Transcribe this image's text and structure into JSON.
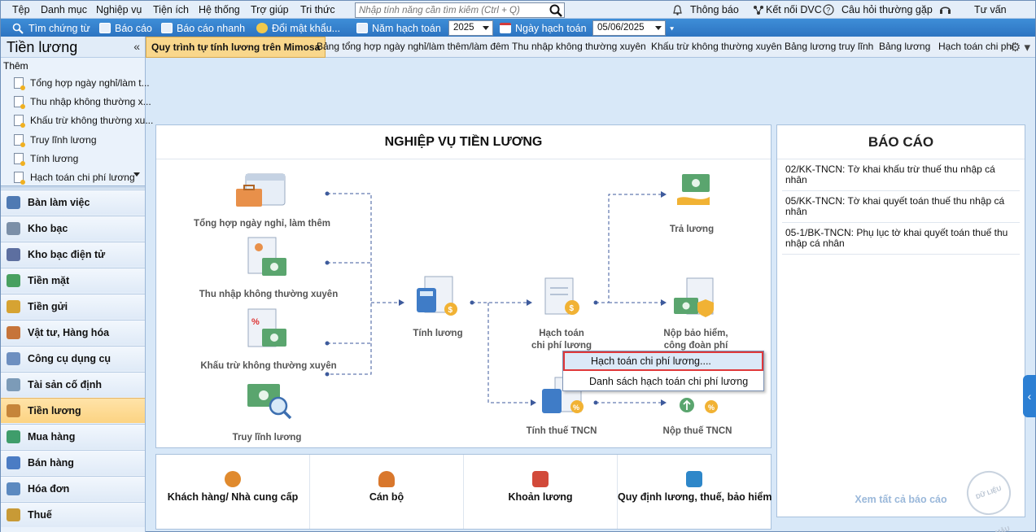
{
  "menubar": {
    "items": [
      "Tệp",
      "Danh mục",
      "Nghiệp vụ",
      "Tiện ích",
      "Hệ thống",
      "Trợ giúp",
      "Tri thức"
    ],
    "search_placeholder": "Nhập tính năng cần tìm kiếm (Ctrl + Q)",
    "notify": "Thông báo",
    "connect": "Kết nối DVC",
    "faq": "Câu hỏi thường gặp",
    "advice": "Tư vấn"
  },
  "toolbar": {
    "find_voucher": "Tìm chứng từ",
    "report": "Báo cáo",
    "quick_report": "Báo cáo nhanh",
    "change_password": "Đổi mật khẩu...",
    "fiscal_year_label": "Năm hạch toán",
    "fiscal_year_value": "2025",
    "posting_date_label": "Ngày hạch toán",
    "posting_date_value": "05/06/2025"
  },
  "leftpanel": {
    "title": "Tiền lương",
    "collapse": "«",
    "them": "Thêm",
    "items": [
      "Tổng hợp ngày nghỉ/làm t...",
      "Thu nhập không thường x...",
      "Khấu trừ không thường xu...",
      "Truy lĩnh lương",
      "Tính lương",
      "Hạch toán chi phí lương"
    ]
  },
  "nav": [
    {
      "label": "Bàn làm việc",
      "color": "#4f7ab3"
    },
    {
      "label": "Kho bạc",
      "color": "#7b8fa8"
    },
    {
      "label": "Kho bạc điện tử",
      "color": "#5d6fa0"
    },
    {
      "label": "Tiền mặt",
      "color": "#48a060"
    },
    {
      "label": "Tiền gửi",
      "color": "#d6a332"
    },
    {
      "label": "Vật tư, Hàng hóa",
      "color": "#c6743a"
    },
    {
      "label": "Công cụ dụng cụ",
      "color": "#6d8fc0"
    },
    {
      "label": "Tài sản cố định",
      "color": "#7c9bb8"
    },
    {
      "label": "Tiền lương",
      "color": "#c6853a"
    },
    {
      "label": "Mua hàng",
      "color": "#3f9d6b"
    },
    {
      "label": "Bán hàng",
      "color": "#4b7cc4"
    },
    {
      "label": "Hóa đơn",
      "color": "#5b89c0"
    },
    {
      "label": "Thuế",
      "color": "#c89a36"
    }
  ],
  "tabs": [
    "Quy trình tự tính lương trên Mimosa",
    "Bảng tổng hợp ngày nghỉ/làm thêm/làm đêm",
    "Thu nhập không thường xuyên",
    "Khấu trừ không thường xuyên",
    "Bảng lương truy lĩnh",
    "Bảng lương",
    "Hạch toán chi phí"
  ],
  "process": {
    "title": "NGHIỆP VỤ TIỀN LƯƠNG",
    "nodes": {
      "tong_hop": "Tổng hợp ngày nghỉ, làm thêm",
      "thu_nhap": "Thu nhập không thường xuyên",
      "khau_tru": "Khấu trừ không thường xuyên",
      "truy_linh": "Truy lĩnh lương",
      "tinh_luong": "Tính lương",
      "hach_toan_1": "Hạch toán",
      "hach_toan_2": "chi phí lương",
      "tra_luong": "Trả lương",
      "nop_bh_1": "Nộp bảo hiểm,",
      "nop_bh_2": "công đoàn phí",
      "tinh_thue": "Tính thuế TNCN",
      "nop_thue": "Nộp thuế TNCN"
    }
  },
  "context_menu": {
    "items": [
      "Hạch toán chi phí lương....",
      "Danh sách hạch toán chi phí lương"
    ]
  },
  "quick": [
    {
      "label": "Khách hàng/ Nhà cung cấp",
      "color": "#e08a2e"
    },
    {
      "label": "Cán bộ",
      "color": "#d9772c"
    },
    {
      "label": "Khoản lương",
      "color": "#d24a3a"
    },
    {
      "label": "Quy định lương, thuế, bảo hiểm",
      "color": "#2e87c9"
    }
  ],
  "reports": {
    "title": "BÁO CÁO",
    "items": [
      "02/KK-TNCN: Tờ khai khấu trừ thuế thu nhập cá nhân",
      "05/KK-TNCN: Tờ khai quyết toán thuế thu nhập cá nhân",
      "05-1/BK-TNCN: Phụ lục tờ khai quyết toán thuế thu nhập cá nhân"
    ],
    "view_all": "Xem tất cả báo cáo",
    "stamp": "DỮ LIỆU MẪU"
  },
  "side_tab": "‹"
}
